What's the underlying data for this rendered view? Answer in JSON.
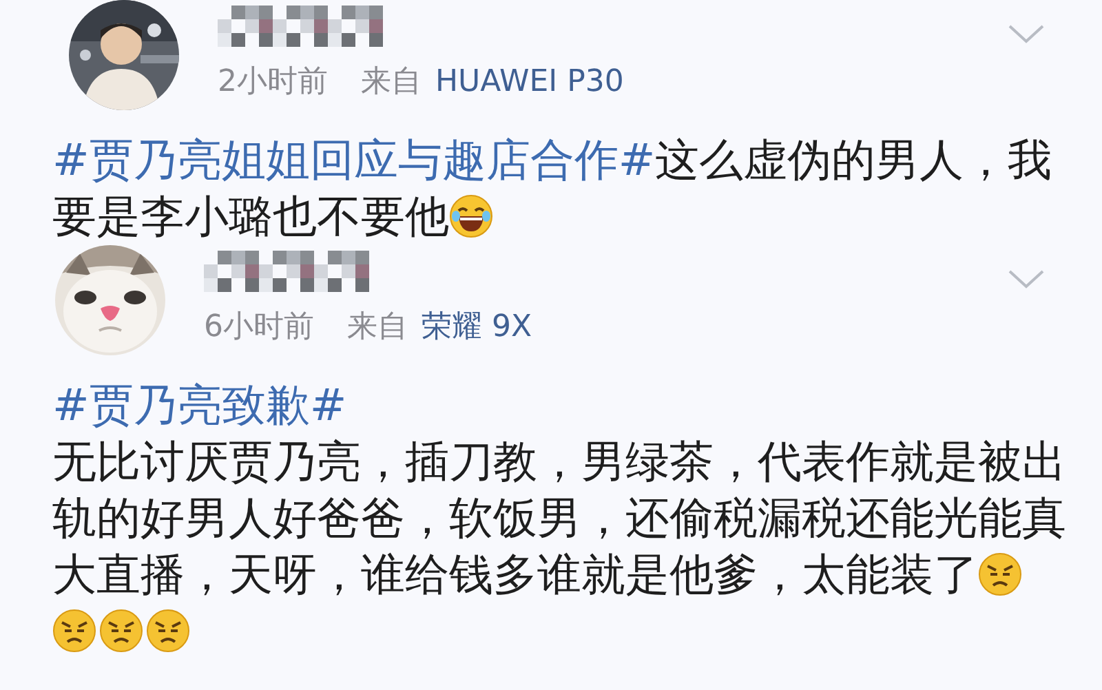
{
  "posts": [
    {
      "avatar": {
        "kind": "person"
      },
      "time": "2小时前",
      "source_label": "来自",
      "device": "HUAWEI P30",
      "paragraphs": [
        [
          {
            "kind": "hashtag",
            "text": "#贾乃亮姐姐回应与趣店合作#"
          },
          {
            "kind": "plain",
            "text": "这么虚伪的男人，我要是李小璐也不要他"
          },
          {
            "kind": "laugh-emoji"
          }
        ]
      ]
    },
    {
      "avatar": {
        "kind": "cat"
      },
      "time": "6小时前",
      "source_label": "来自",
      "device": "荣耀 9X",
      "paragraphs": [
        [
          {
            "kind": "hashtag",
            "text": "#贾乃亮致歉#"
          }
        ],
        [
          {
            "kind": "plain",
            "text": "无比讨厌贾乃亮，插刀教，男绿茶，代表作就是被出轨的好男人好爸爸，软饭男，还偷税漏税还能光能真大直播，天呀，谁给钱多谁就是他爹，太能装了"
          },
          {
            "kind": "angry-emoji"
          },
          {
            "kind": "angry-emoji"
          },
          {
            "kind": "angry-emoji"
          },
          {
            "kind": "angry-emoji"
          }
        ]
      ]
    }
  ]
}
